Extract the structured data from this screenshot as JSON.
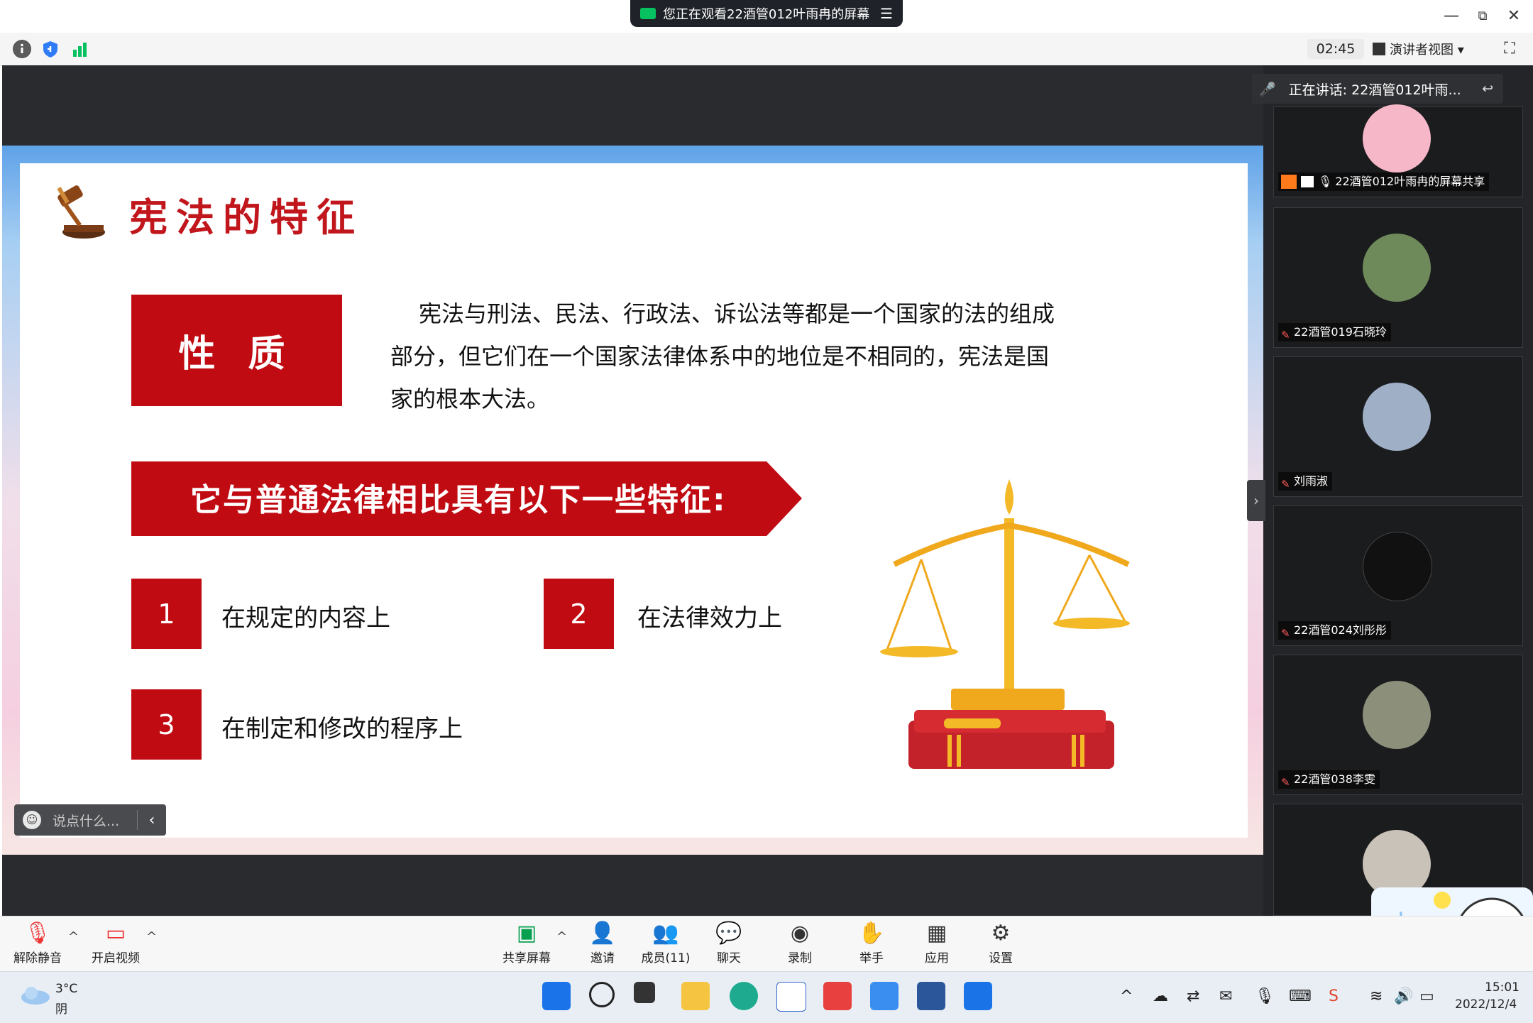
{
  "titlebar": {
    "banner_text": "您正在观看22酒管012叶雨冉的屏幕",
    "minimize": "—",
    "restore": "⧉",
    "close": "✕"
  },
  "toolbar": {
    "timer": "02:45",
    "view_label": "演讲者视图 ▾"
  },
  "slide": {
    "title": "宪法的特征",
    "nature_label": "性 质",
    "nature_text": "宪法与刑法、民法、行政法、诉讼法等都是一个国家的法的组成部分，但它们在一个国家法律体系中的地位是不相同的，宪法是国家的根本大法。",
    "banner_text": "它与普通法律相比具有以下一些特征:",
    "features": [
      {
        "num": "1",
        "text": "在规定的内容上"
      },
      {
        "num": "2",
        "text": "在法律效力上"
      },
      {
        "num": "3",
        "text": "在制定和修改的程序上"
      }
    ]
  },
  "chat": {
    "placeholder": "说点什么...",
    "arrow": "‹"
  },
  "speaking": {
    "label": "正在讲话: 22酒管012叶雨..."
  },
  "participants": [
    {
      "name": "22酒管012叶雨冉的屏幕共享",
      "avatar_color": "#f6b7c8"
    },
    {
      "name": "22酒管019石晓玲",
      "avatar_color": "#6e8a5a"
    },
    {
      "name": "刘雨淑",
      "avatar_color": "#9fb0c6"
    },
    {
      "name": "22酒管024刘彤彤",
      "avatar_color": "#111111"
    },
    {
      "name": "22酒管038李雯",
      "avatar_color": "#8c8f7a"
    },
    {
      "name": "",
      "avatar_color": "#c9c2b8"
    }
  ],
  "controls": {
    "unmute": "解除静音",
    "start_video": "开启视频",
    "share_screen": "共享屏幕",
    "invite": "邀请",
    "members": "成员(11)",
    "chat": "聊天",
    "record": "录制",
    "raise_hand": "举手",
    "apps": "应用",
    "settings": "设置"
  },
  "taskbar": {
    "temperature": "3°C",
    "weather": "阴",
    "time": "15:01",
    "date": "2022/12/4"
  },
  "colors": {
    "accent_red": "#c10b12",
    "title_red": "#c0161c",
    "dark_bg": "#2a2b2e"
  }
}
